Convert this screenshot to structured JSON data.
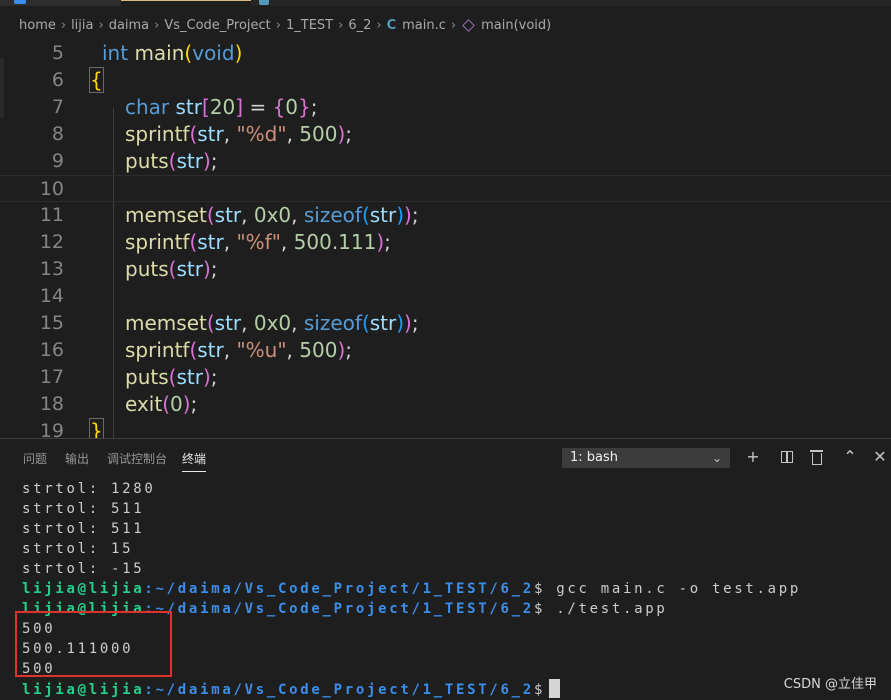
{
  "breadcrumb": {
    "items": [
      "home",
      "lijia",
      "daima",
      "Vs_Code_Project",
      "1_TEST",
      "6_2"
    ],
    "file": "main.c",
    "file_icon": "C",
    "symbol": "main(void)"
  },
  "editor": {
    "line_numbers": [
      "5",
      "6",
      "7",
      "8",
      "9",
      "10",
      "11",
      "12",
      "13",
      "14",
      "15",
      "16",
      "17",
      "18",
      "19"
    ]
  },
  "panel": {
    "tabs": [
      "问题",
      "输出",
      "调试控制台",
      "终端"
    ],
    "active_tab": "终端",
    "terminal_select": "1: bash",
    "actions": [
      "plus-icon",
      "split-icon",
      "trash-icon",
      "chevron-up-icon",
      "close-icon"
    ]
  },
  "terminal": {
    "lines": [
      "strtol: 1280",
      "strtol: 511",
      "strtol: 511",
      "strtol: 15",
      "strtol: -15"
    ],
    "prompt_user": "lijia@lijia",
    "prompt_path": ":~/daima/Vs_Code_Project/1_TEST/6_2",
    "cmd1": "$ gcc main.c -o test.app",
    "cmd2": "$ ./test.app",
    "out1": "500",
    "out2": "500.111000",
    "out3": "500",
    "cmd3": "$"
  },
  "watermark": "CSDN @立佳甲",
  "colors": {
    "background": "#1e1e1e",
    "keyword": "#569cd6",
    "function": "#dcdcaa",
    "variable": "#9cdcfe",
    "string": "#ce9178",
    "number": "#b5cea8",
    "prompt_user": "#23d18b",
    "prompt_path": "#3b8eea",
    "highlight_box": "#e0322d"
  }
}
